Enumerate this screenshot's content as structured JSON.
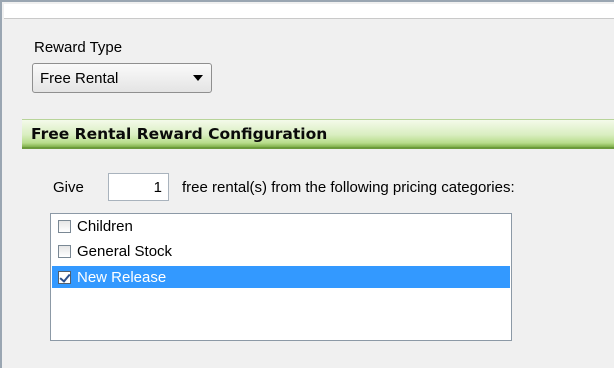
{
  "reward_type": {
    "label": "Reward Type",
    "selected": "Free Rental"
  },
  "section": {
    "title": "Free Rental Reward Configuration"
  },
  "give": {
    "prefix": "Give",
    "count": "1",
    "suffix": "free rental(s) from the following pricing categories:"
  },
  "categories": [
    {
      "label": "Children",
      "checked": false,
      "selected": false
    },
    {
      "label": "General Stock",
      "checked": false,
      "selected": false
    },
    {
      "label": "New Release",
      "checked": true,
      "selected": true
    }
  ],
  "colors": {
    "header_green": "#7fb04a",
    "selection_blue": "#3399ff"
  }
}
